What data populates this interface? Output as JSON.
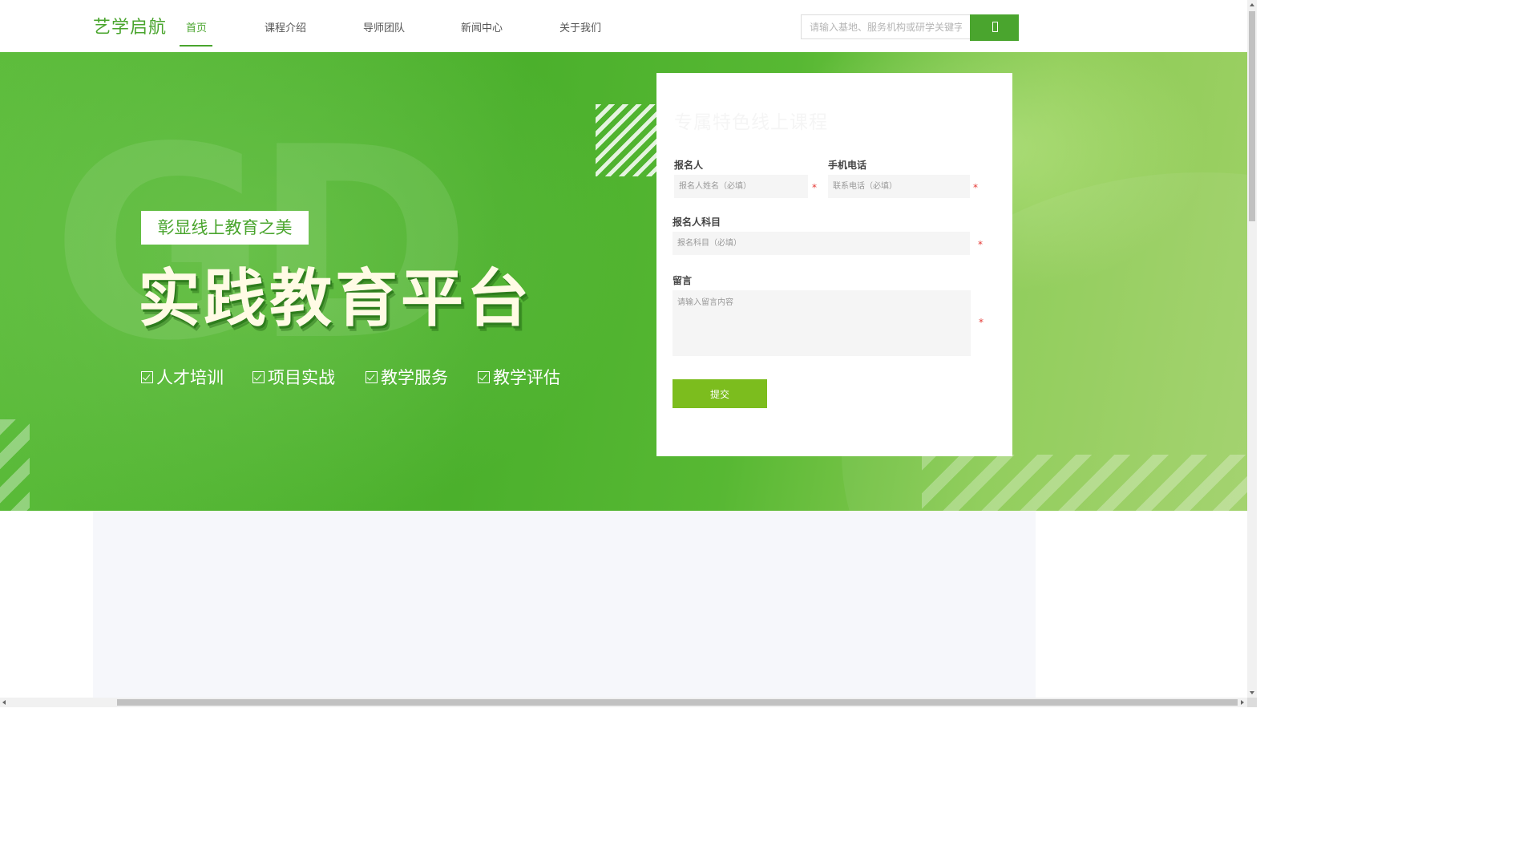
{
  "header": {
    "logo": "艺学启航",
    "nav": [
      {
        "label": "首页",
        "active": true
      },
      {
        "label": "课程介绍",
        "active": false
      },
      {
        "label": "导师团队",
        "active": false
      },
      {
        "label": "新闻中心",
        "active": false
      },
      {
        "label": "关于我们",
        "active": false
      }
    ],
    "search": {
      "placeholder": "请输入基地、服务机构或研学关键字",
      "icon": "search-icon"
    }
  },
  "hero": {
    "ghost_text": "GD",
    "tag": "彰显线上教育之美",
    "headline": "实践教育平台",
    "features": [
      "人才培训",
      "项目实战",
      "教学服务",
      "教学评估"
    ]
  },
  "form": {
    "title": "专属特色线上课程",
    "name_label": "报名人",
    "name_placeholder": "报名人姓名（必填）",
    "phone_label": "手机电话",
    "phone_placeholder": "联系电话（必填）",
    "subject_label": "报名人科目",
    "subject_placeholder": "报名科目（必填）",
    "message_label": "留言",
    "message_placeholder": "请输入留言内容",
    "required_mark": "*",
    "submit_label": "提交"
  },
  "colors": {
    "accent": "#4aa52e",
    "submit": "#7cbd1e",
    "required": "#e53935"
  }
}
